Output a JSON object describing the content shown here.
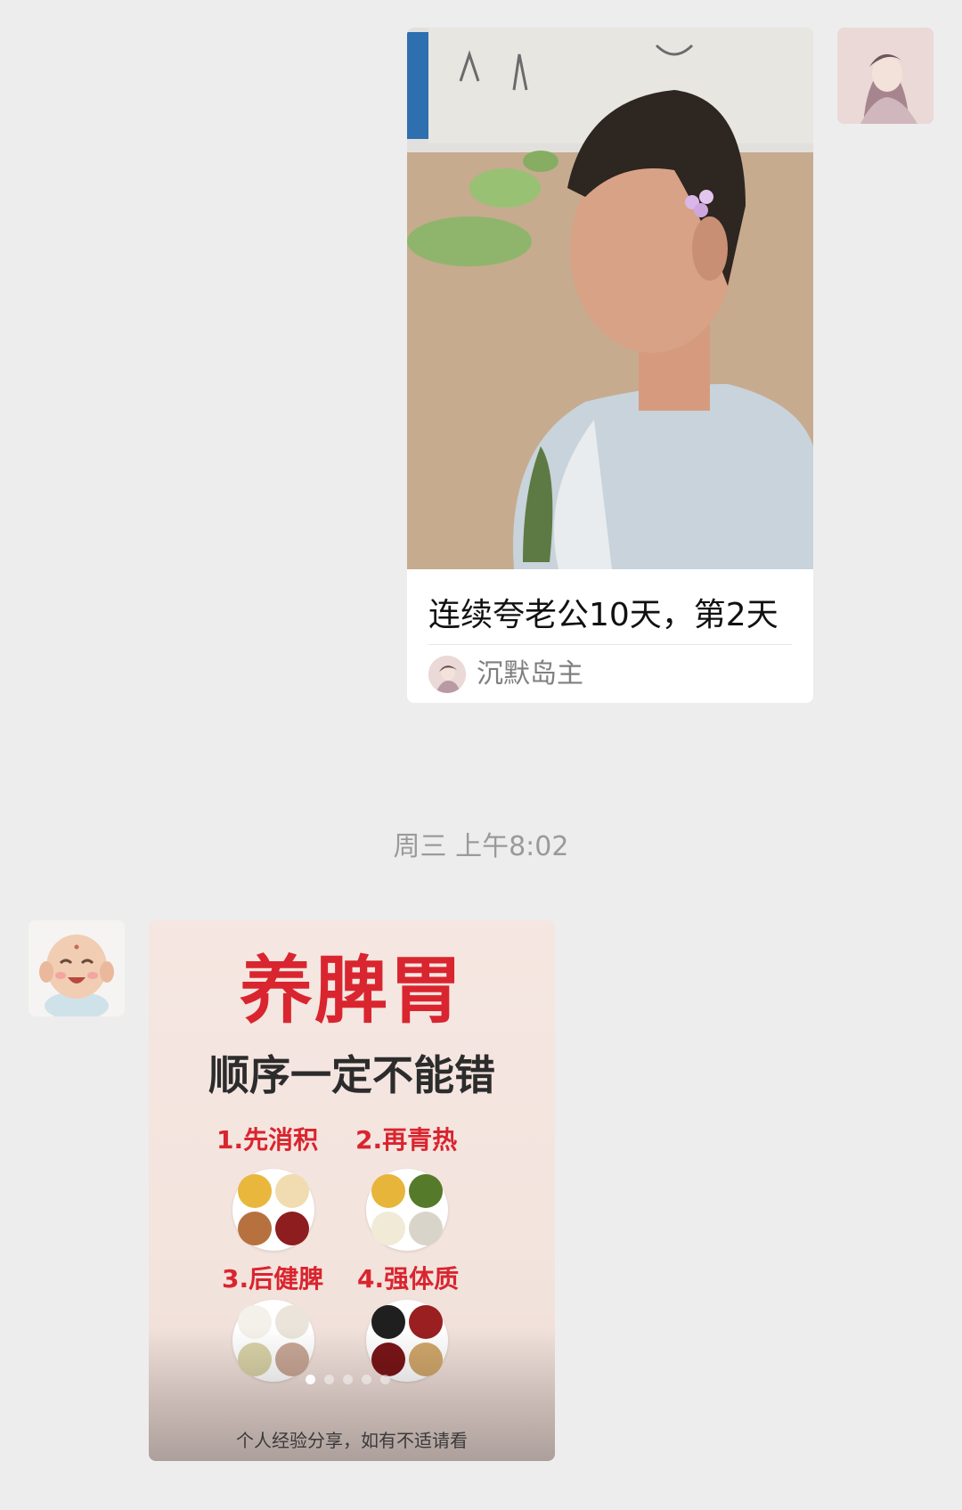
{
  "messages": {
    "share": {
      "title": "连续夸老公10天，第2天",
      "author": "沉默岛主"
    },
    "timestamp": "周三 上午8:02",
    "image_post": {
      "headline": "养脾胃",
      "subhead": "顺序一定不能错",
      "steps": [
        {
          "label": "1.先消积"
        },
        {
          "label": "2.再青热"
        },
        {
          "label": "3.后健脾"
        },
        {
          "label": "4.强体质"
        }
      ],
      "caption": "个人经验分享，如有不适请看",
      "pager": {
        "total": 5,
        "active": 1
      }
    }
  },
  "colors": {
    "chat_background": "#ededed",
    "headline_red": "#d9252f",
    "timestamp_gray": "#9a9a9a",
    "author_gray": "#7f7f7f"
  },
  "icons": {
    "avatar_me": "anime-girl-avatar",
    "avatar_friend": "smiling-buddha-avatar"
  }
}
